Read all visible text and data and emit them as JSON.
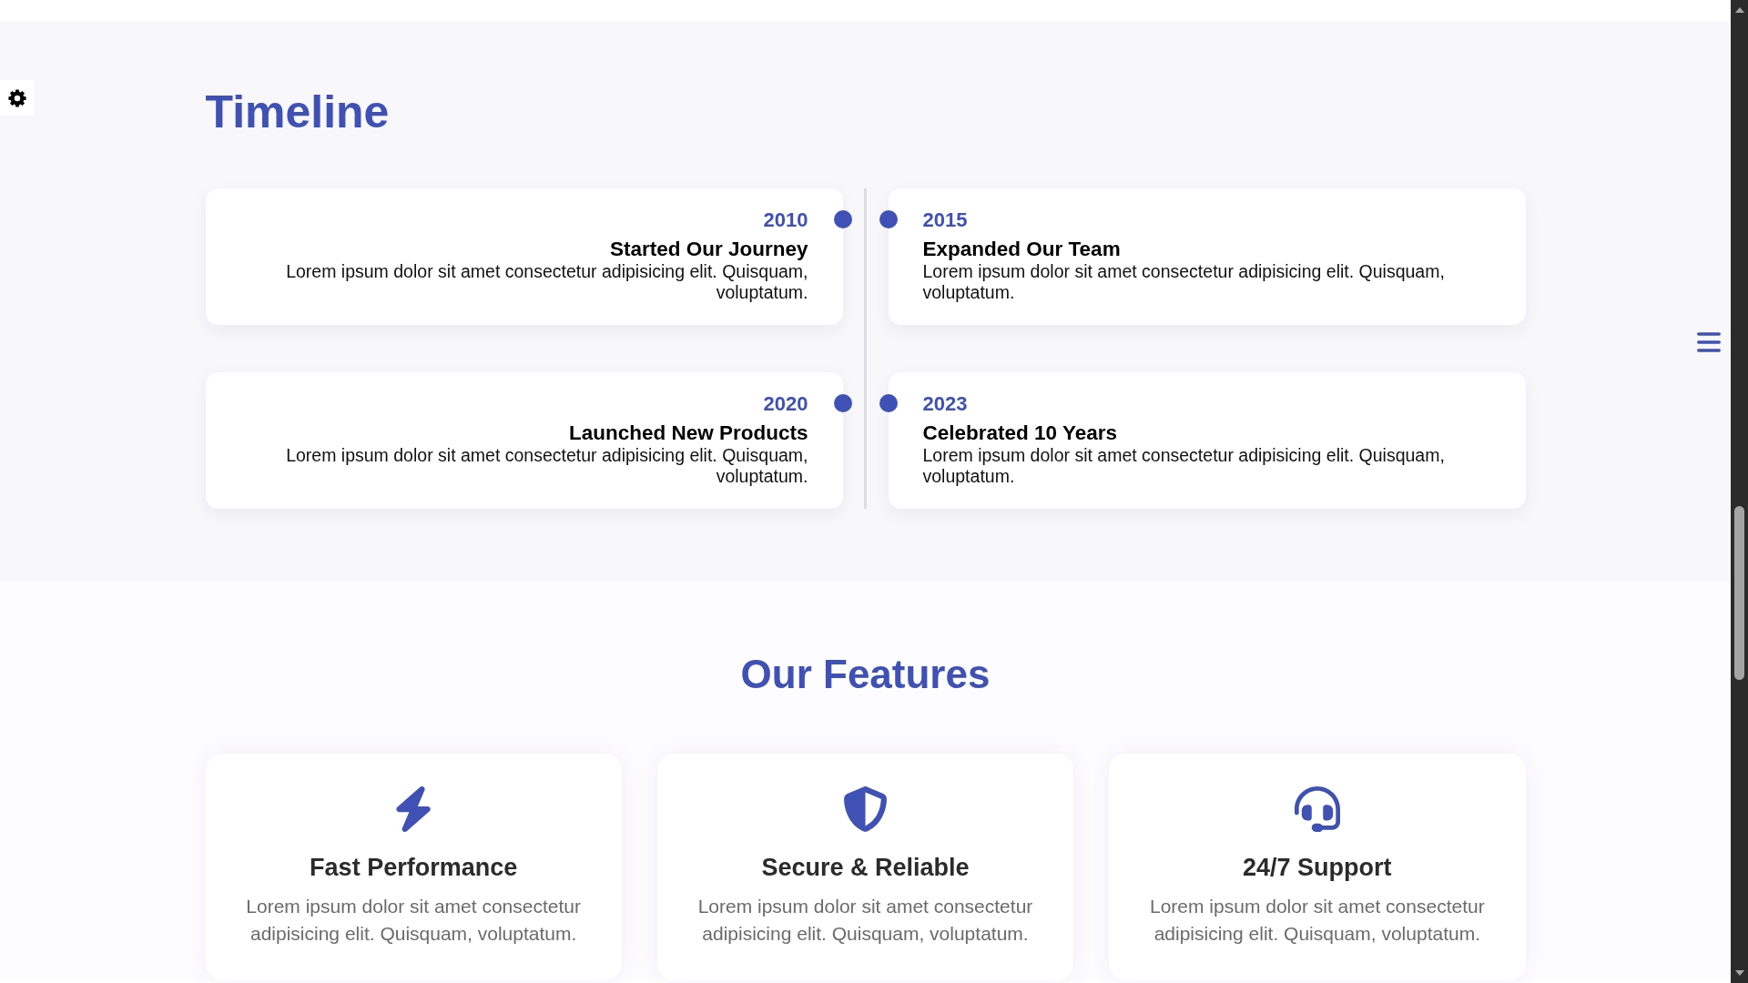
{
  "timeline": {
    "title": "Timeline",
    "events": [
      {
        "year": "2010",
        "title": "Started Our Journey",
        "text": "Lorem ipsum dolor sit amet consectetur adipisicing elit. Quisquam, voluptatum."
      },
      {
        "year": "2015",
        "title": "Expanded Our Team",
        "text": "Lorem ipsum dolor sit amet consectetur adipisicing elit. Quisquam, voluptatum."
      },
      {
        "year": "2020",
        "title": "Launched New Products",
        "text": "Lorem ipsum dolor sit amet consectetur adipisicing elit. Quisquam, voluptatum."
      },
      {
        "year": "2023",
        "title": "Celebrated 10 Years",
        "text": "Lorem ipsum dolor sit amet consectetur adipisicing elit. Quisquam, voluptatum."
      }
    ]
  },
  "features": {
    "title": "Our Features",
    "items": [
      {
        "title": "Fast Performance",
        "text": "Lorem ipsum dolor sit amet consectetur adipisicing elit. Quisquam, voluptatum."
      },
      {
        "title": "Secure & Reliable",
        "text": "Lorem ipsum dolor sit amet consectetur adipisicing elit. Quisquam, voluptatum."
      },
      {
        "title": "24/7 Support",
        "text": "Lorem ipsum dolor sit amet consectetur adipisicing elit. Quisquam, voluptatum."
      }
    ]
  }
}
